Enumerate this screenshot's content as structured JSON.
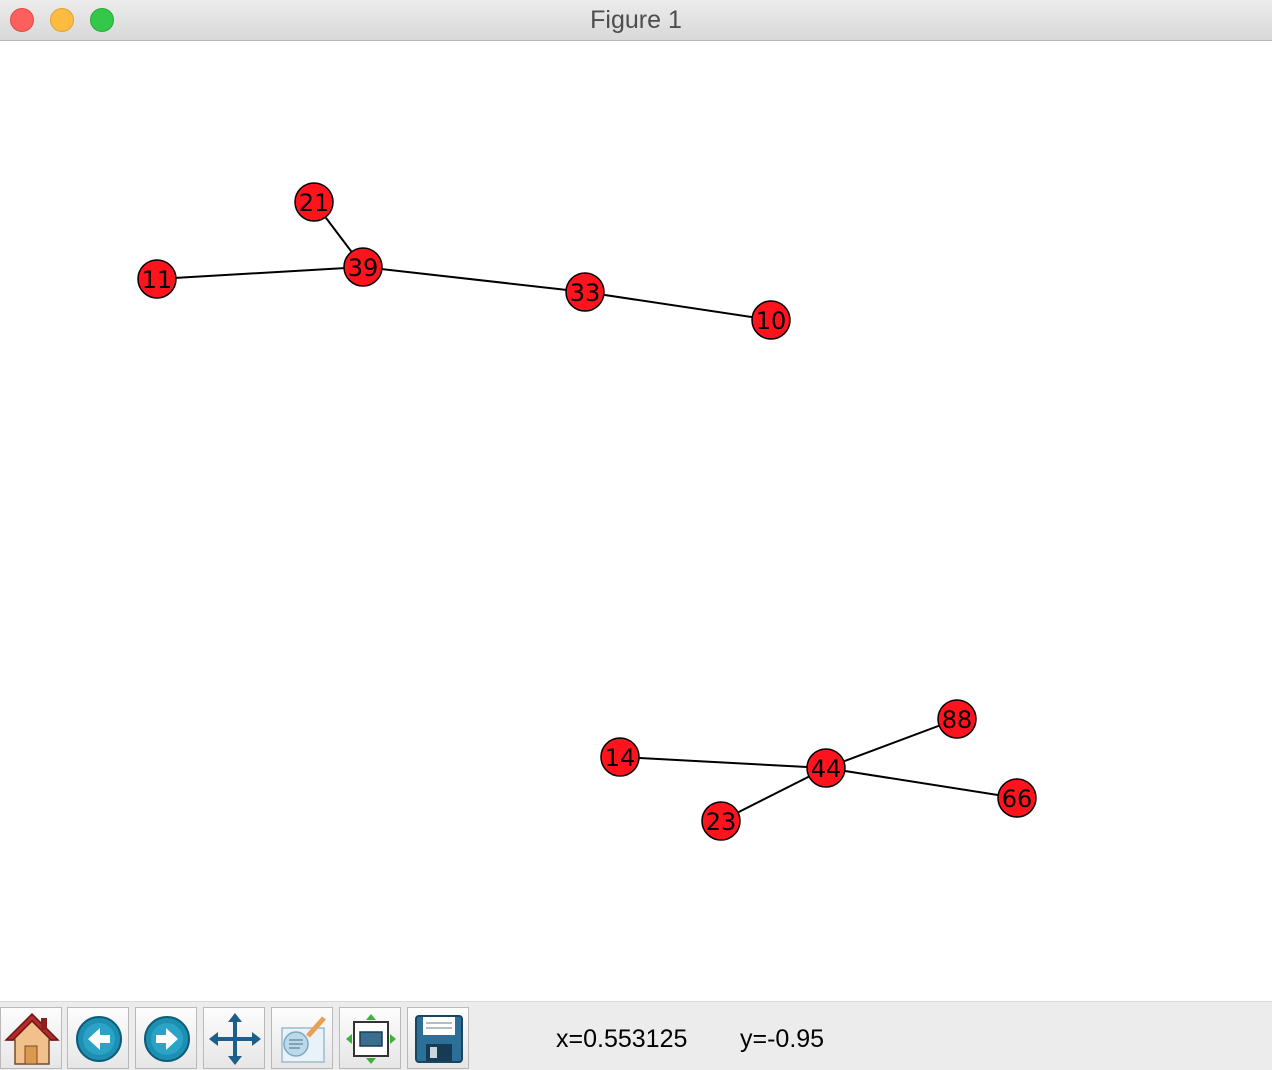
{
  "window": {
    "title": "Figure 1"
  },
  "graph": {
    "node_color": "#ff141e",
    "edge_color": "#000000",
    "nodes": [
      {
        "id": "21"
      },
      {
        "id": "39"
      },
      {
        "id": "11"
      },
      {
        "id": "33"
      },
      {
        "id": "10"
      },
      {
        "id": "88"
      },
      {
        "id": "14"
      },
      {
        "id": "44"
      },
      {
        "id": "66"
      },
      {
        "id": "23"
      }
    ],
    "edges": [
      [
        "21",
        "39"
      ],
      [
        "11",
        "39"
      ],
      [
        "39",
        "33"
      ],
      [
        "33",
        "10"
      ],
      [
        "14",
        "44"
      ],
      [
        "44",
        "88"
      ],
      [
        "44",
        "66"
      ],
      [
        "44",
        "23"
      ]
    ]
  },
  "toolbar": {
    "buttons": [
      {
        "icon": "home-icon"
      },
      {
        "icon": "back-arrow-icon"
      },
      {
        "icon": "forward-arrow-icon"
      },
      {
        "icon": "pan-icon"
      },
      {
        "icon": "zoom-rect-icon"
      },
      {
        "icon": "subplots-configure-icon"
      },
      {
        "icon": "save-floppy-icon"
      }
    ],
    "x_readout": "x=0.553125",
    "y_readout": "y=-0.95"
  }
}
